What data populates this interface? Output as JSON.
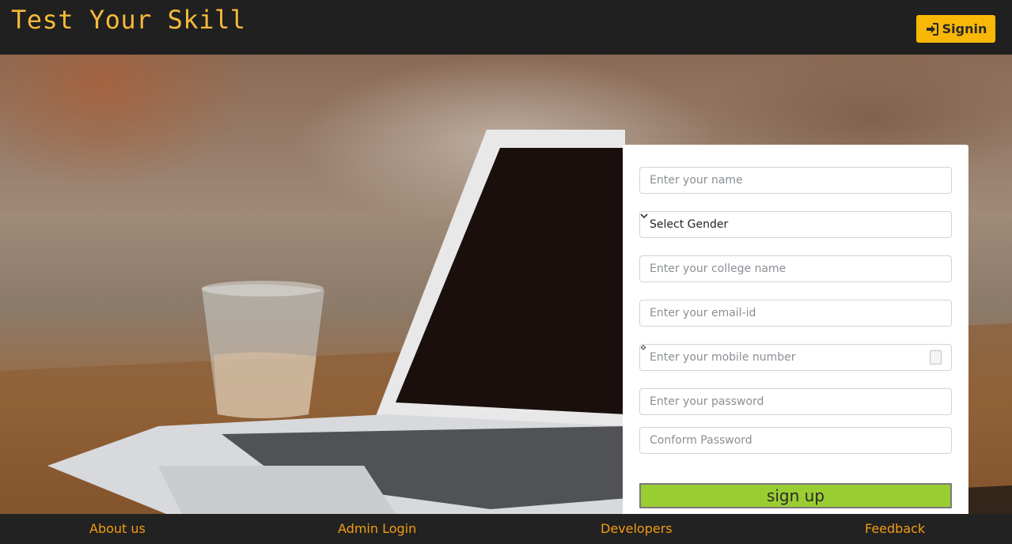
{
  "header": {
    "brand": "Test Your Skill",
    "signin_label": "Signin",
    "signin_icon": "sign-in-icon"
  },
  "form": {
    "name_placeholder": "Enter your name",
    "gender_selected": "Select Gender",
    "college_placeholder": "Enter your college name",
    "email_placeholder": "Enter your email-id",
    "mobile_placeholder": "Enter your mobile number",
    "password_placeholder": "Enter your password",
    "confirm_placeholder": "Conform Password",
    "submit_label": "sign up"
  },
  "footer": {
    "links": [
      "About us",
      "Admin Login",
      "Developers",
      "Feedback"
    ]
  },
  "colors": {
    "accent": "#f9b707",
    "brand_text": "#f6b93b",
    "submit": "#9acd32",
    "footer_link": "#f39c12",
    "bar": "#202020"
  }
}
